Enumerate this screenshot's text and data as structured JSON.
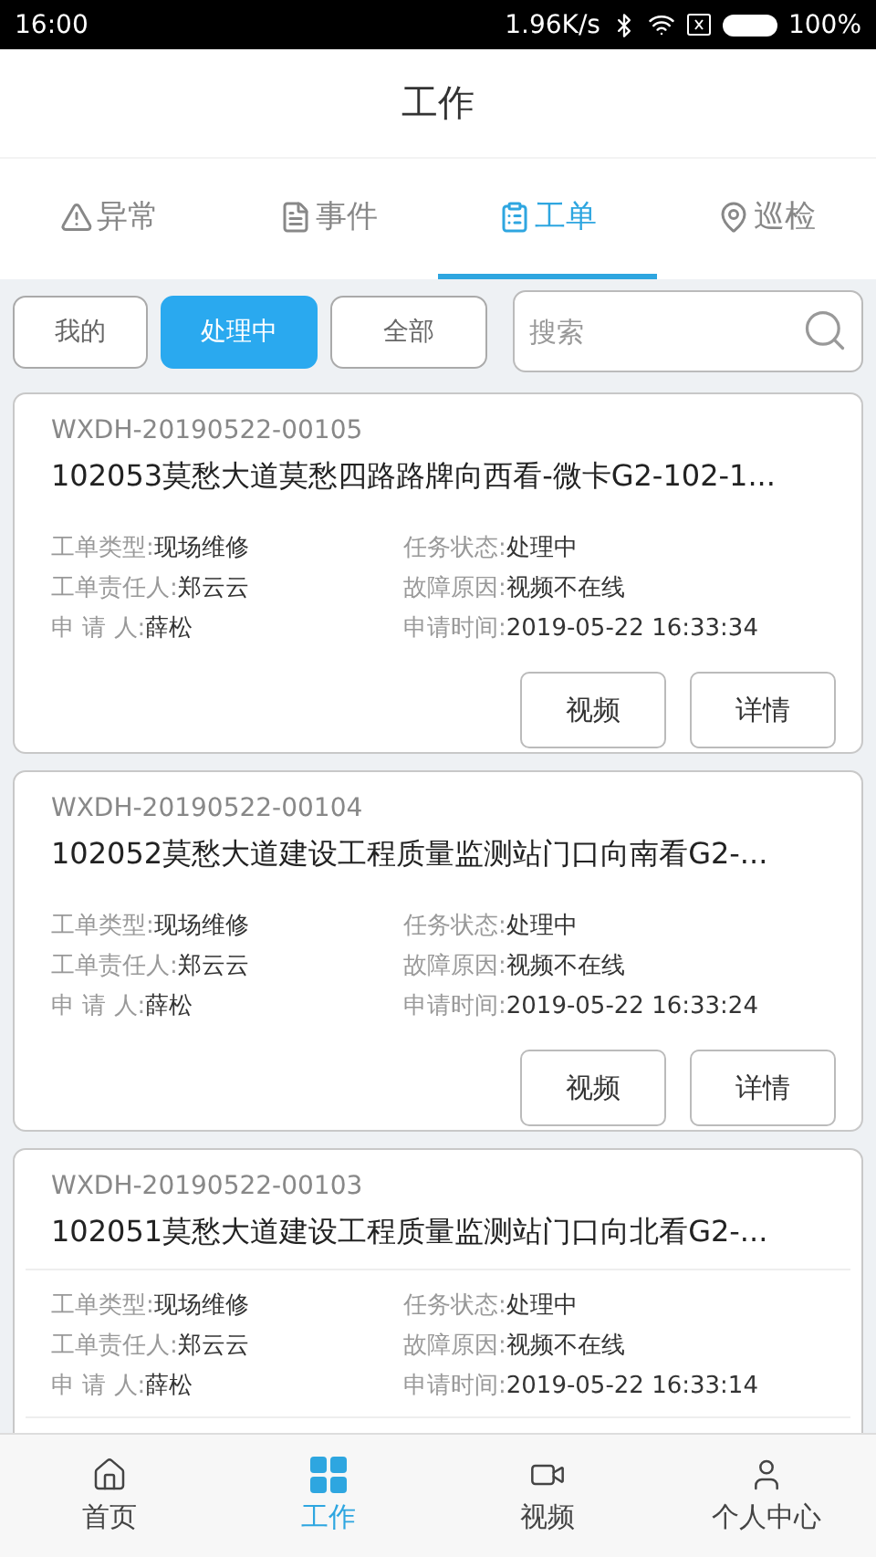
{
  "status_bar": {
    "time": "16:00",
    "speed": "1.96K/s",
    "battery": "100%"
  },
  "title": "工作",
  "tabs": [
    {
      "label": "异常",
      "selected": false
    },
    {
      "label": "事件",
      "selected": false
    },
    {
      "label": "工单",
      "selected": true
    },
    {
      "label": "巡检",
      "selected": false
    }
  ],
  "filters": [
    {
      "label": "我的",
      "selected": false
    },
    {
      "label": "处理中",
      "selected": true
    },
    {
      "label": "全部",
      "selected": false
    }
  ],
  "search": {
    "placeholder": "搜索"
  },
  "cards": [
    {
      "code": "WXDH-20190522-00105",
      "title": "102053莫愁大道莫愁四路路牌向西看-微卡G2-102-1...",
      "fields": [
        {
          "label": "工单类型:",
          "value": "现场维修"
        },
        {
          "label": "任务状态:",
          "value": "处理中"
        },
        {
          "label": "工单责任人:",
          "value": "郑云云"
        },
        {
          "label": "故障原因:",
          "value": "视频不在线"
        },
        {
          "label": "申 请 人:",
          "value": "薛松"
        },
        {
          "label": "申请时间:",
          "value": "2019-05-22 16:33:34"
        }
      ],
      "buttons": [
        "视频",
        "详情"
      ]
    },
    {
      "code": "WXDH-20190522-00104",
      "title": "102052莫愁大道建设工程质量监测站门口向南看G2-...",
      "fields": [
        {
          "label": "工单类型:",
          "value": "现场维修"
        },
        {
          "label": "任务状态:",
          "value": "处理中"
        },
        {
          "label": "工单责任人:",
          "value": "郑云云"
        },
        {
          "label": "故障原因:",
          "value": "视频不在线"
        },
        {
          "label": "申 请 人:",
          "value": "薛松"
        },
        {
          "label": "申请时间:",
          "value": "2019-05-22 16:33:24"
        }
      ],
      "buttons": [
        "视频",
        "详情"
      ]
    },
    {
      "code": "WXDH-20190522-00103",
      "title": "102051莫愁大道建设工程质量监测站门口向北看G2-...",
      "fields": [
        {
          "label": "工单类型:",
          "value": "现场维修"
        },
        {
          "label": "任务状态:",
          "value": "处理中"
        },
        {
          "label": "工单责任人:",
          "value": "郑云云"
        },
        {
          "label": "故障原因:",
          "value": "视频不在线"
        },
        {
          "label": "申 请 人:",
          "value": "薛松"
        },
        {
          "label": "申请时间:",
          "value": "2019-05-22 16:33:14"
        }
      ]
    }
  ],
  "nav": [
    {
      "label": "首页",
      "selected": false
    },
    {
      "label": "工作",
      "selected": true
    },
    {
      "label": "视频",
      "selected": false
    },
    {
      "label": "个人中心",
      "selected": false
    }
  ]
}
